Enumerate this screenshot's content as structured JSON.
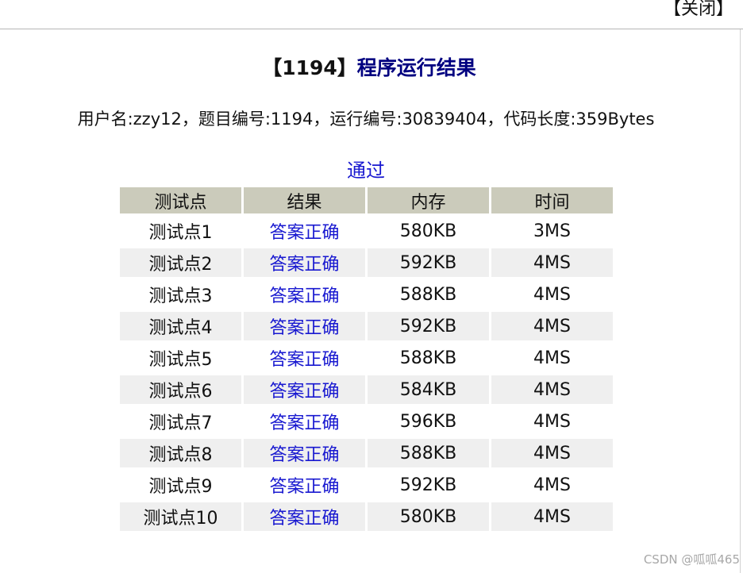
{
  "header": {
    "close_label": "【关闭】"
  },
  "title": {
    "problem_id": "【1194】",
    "text": "程序运行结果"
  },
  "info": {
    "line": "用户名:zzy12，题目编号:1194，运行编号:30839404，代码长度:359Bytes"
  },
  "verdict": "通过",
  "table": {
    "columns": [
      "测试点",
      "结果",
      "内存",
      "时间"
    ],
    "rows": [
      [
        "测试点1",
        "答案正确",
        "580KB",
        "3MS"
      ],
      [
        "测试点2",
        "答案正确",
        "592KB",
        "4MS"
      ],
      [
        "测试点3",
        "答案正确",
        "588KB",
        "4MS"
      ],
      [
        "测试点4",
        "答案正确",
        "592KB",
        "4MS"
      ],
      [
        "测试点5",
        "答案正确",
        "588KB",
        "4MS"
      ],
      [
        "测试点6",
        "答案正确",
        "584KB",
        "4MS"
      ],
      [
        "测试点7",
        "答案正确",
        "596KB",
        "4MS"
      ],
      [
        "测试点8",
        "答案正确",
        "588KB",
        "4MS"
      ],
      [
        "测试点9",
        "答案正确",
        "592KB",
        "4MS"
      ],
      [
        "测试点10",
        "答案正确",
        "580KB",
        "4MS"
      ]
    ]
  },
  "watermark": "CSDN @呱呱465",
  "colors": {
    "title": "#000080",
    "link": "#1818d0",
    "header_row": "#cbcbbb",
    "alt_row": "#efefef"
  }
}
